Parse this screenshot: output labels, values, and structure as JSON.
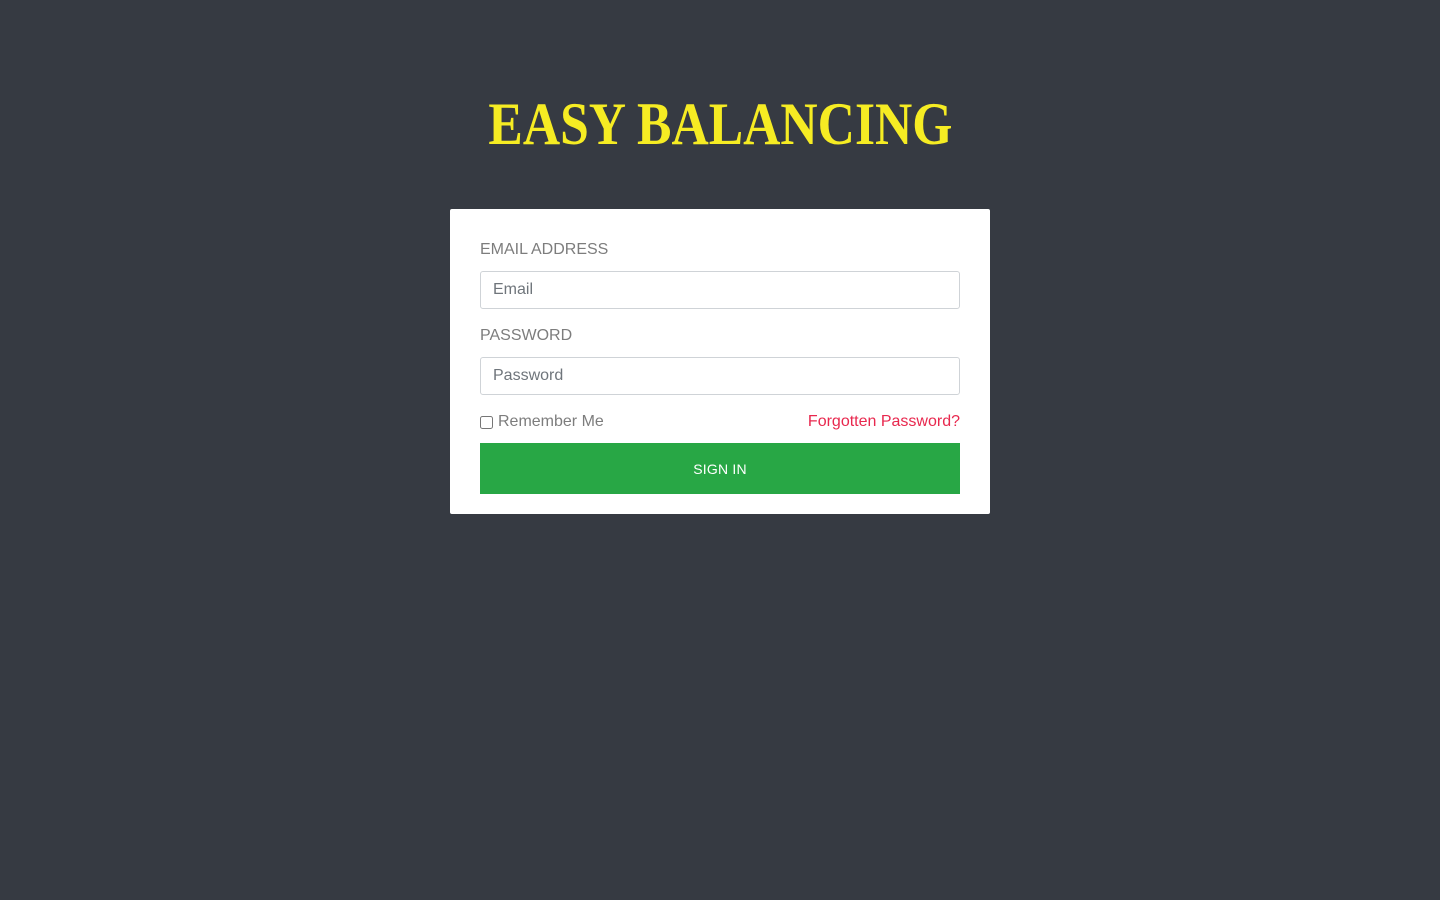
{
  "brand": {
    "logo_text": "EASY BALANCING",
    "logo_color": "#f6ec23"
  },
  "colors": {
    "background": "#363a42",
    "card": "#ffffff",
    "primary_button": "#28a745",
    "link": "#e8284e",
    "label": "#7d7d7d"
  },
  "login_form": {
    "email": {
      "label": "EMAIL ADDRESS",
      "placeholder": "Email",
      "value": ""
    },
    "password": {
      "label": "PASSWORD",
      "placeholder": "Password",
      "value": ""
    },
    "remember_label": "Remember Me",
    "forgot_link": "Forgotten Password?",
    "submit_label": "SIGN IN"
  }
}
